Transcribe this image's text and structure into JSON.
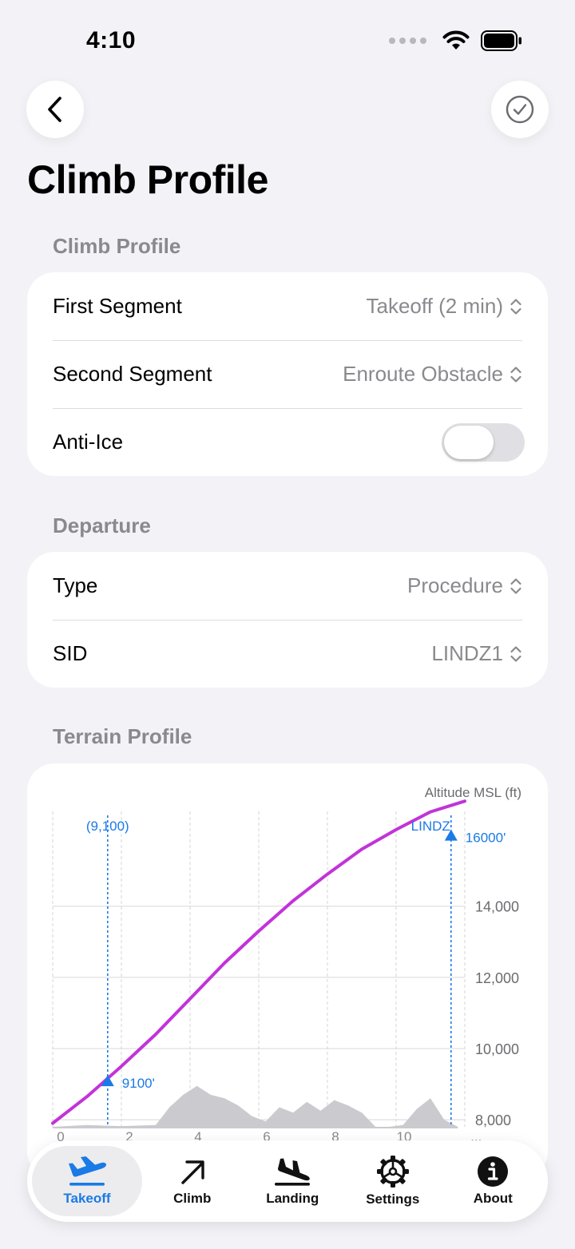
{
  "status_bar": {
    "time": "4:10"
  },
  "page": {
    "title": "Climb Profile"
  },
  "sections": {
    "climb_profile": {
      "header": "Climb Profile",
      "rows": [
        {
          "label": "First Segment",
          "value": "Takeoff (2 min)"
        },
        {
          "label": "Second Segment",
          "value": "Enroute Obstacle"
        },
        {
          "label": "Anti-Ice",
          "toggle": false
        }
      ]
    },
    "departure": {
      "header": "Departure",
      "rows": [
        {
          "label": "Type",
          "value": "Procedure"
        },
        {
          "label": "SID",
          "value": "LINDZ1"
        }
      ]
    },
    "terrain_profile": {
      "header": "Terrain Profile"
    }
  },
  "chart_data": {
    "type": "line",
    "ylabel": "Altitude MSL (ft)",
    "xlim": [
      0,
      12
    ],
    "ylim": [
      7800,
      17000
    ],
    "x_ticks": [
      "0",
      "2",
      "4",
      "6",
      "8",
      "10",
      "..."
    ],
    "y_ticks": [
      {
        "value": 8000,
        "label": "8,000"
      },
      {
        "value": 10000,
        "label": "10,000"
      },
      {
        "value": 12000,
        "label": "12,000"
      },
      {
        "value": 14000,
        "label": "14,000"
      }
    ],
    "climb_path": {
      "color": "#c233d9",
      "x": [
        0,
        1,
        2,
        3,
        4,
        5,
        6,
        7,
        8,
        9,
        10,
        11,
        12
      ],
      "y": [
        7900,
        8650,
        9500,
        10400,
        11400,
        12400,
        13300,
        14150,
        14900,
        15600,
        16150,
        16650,
        16950
      ]
    },
    "terrain": {
      "color": "#c7c7cc",
      "x": [
        0,
        1,
        2,
        3,
        3.4,
        3.8,
        4.2,
        4.6,
        5,
        5.4,
        5.8,
        6.2,
        6.6,
        7,
        7.4,
        7.8,
        8.2,
        8.6,
        9,
        9.4,
        9.8,
        10.2,
        10.6,
        11,
        11.4,
        11.8
      ],
      "y": [
        7800,
        7850,
        7820,
        7850,
        8350,
        8700,
        8950,
        8700,
        8600,
        8400,
        8100,
        7950,
        8350,
        8200,
        8500,
        8250,
        8550,
        8400,
        8200,
        7800,
        7800,
        7850,
        8300,
        8600,
        8000,
        7800
      ]
    },
    "markers": [
      {
        "x": 1.6,
        "altitude": 9100,
        "top_label": "(9,100)",
        "point_label": "9100'",
        "color": "#1a7ae6"
      },
      {
        "x": 11.6,
        "altitude": 16000,
        "top_label": "LINDZ",
        "point_label": "16000'",
        "color": "#1a7ae6"
      }
    ]
  },
  "tab_bar": {
    "tabs": [
      {
        "label": "Takeoff",
        "icon": "takeoff-icon",
        "active": true
      },
      {
        "label": "Climb",
        "icon": "climb-arrow-icon",
        "active": false
      },
      {
        "label": "Landing",
        "icon": "landing-icon",
        "active": false
      },
      {
        "label": "Settings",
        "icon": "gear-icon",
        "active": false
      },
      {
        "label": "About",
        "icon": "info-icon",
        "active": false
      }
    ]
  },
  "colors": {
    "accent": "#1a7ae6",
    "climb_path": "#c233d9",
    "background": "#f2f2f7"
  }
}
